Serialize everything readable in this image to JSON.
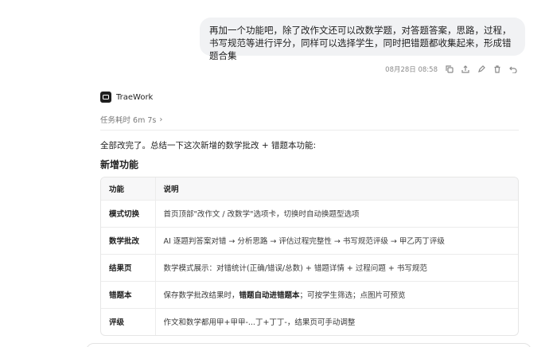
{
  "user_message": {
    "text": "再加一个功能吧，除了改作文还可以改数学题，对答题答案，思路，过程，书写规范等进行评分，同样可以选择学生，同时把错题都收集起来，形成错题合集",
    "timestamp": "08月28日 08:58",
    "actions": [
      "copy-icon",
      "share-icon",
      "edit-icon",
      "delete-icon",
      "undo-icon"
    ]
  },
  "agent": {
    "name": "TraeWork",
    "task_time": "任务耗时 6m 7s",
    "summary": "全部改完了。总结一下这次新增的数学批改 + 错题本功能:",
    "section_title": "新增功能",
    "table": {
      "headers": [
        "功能",
        "说明"
      ],
      "rows": [
        {
          "feature": "模式切换",
          "desc_pre": "首页顶部\"改作文 / 改数学\"选项卡，切换时自动换题型选项",
          "desc_bold": "",
          "desc_post": ""
        },
        {
          "feature": "数学批改",
          "desc_pre": "AI 逐题判答案对错 → 分析思路 → 评估过程完整性 → 书写规范评级 → 甲乙丙丁评级",
          "desc_bold": "",
          "desc_post": ""
        },
        {
          "feature": "结果页",
          "desc_pre": "数学模式展示：对错统计(正确/错误/总数) + 错题详情 + 过程问题 + 书写规范",
          "desc_bold": "",
          "desc_post": ""
        },
        {
          "feature": "错题本",
          "desc_pre": "保存数学批改结果时，",
          "desc_bold": "错题自动进错题本",
          "desc_post": "；可按学生筛选；点图片可预览"
        },
        {
          "feature": "评级",
          "desc_pre": "作文和数学都用甲+甲甲-...丁+丁丁-，结果页可手动调整",
          "desc_bold": "",
          "desc_post": ""
        }
      ]
    }
  }
}
